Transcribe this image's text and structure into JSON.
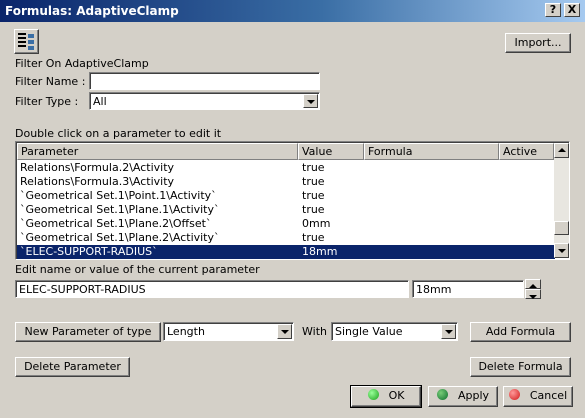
{
  "window": {
    "title": "Formulas: AdaptiveClamp",
    "help_button": "?",
    "close_button": "X"
  },
  "toolbar": {
    "import_label": "Import..."
  },
  "filter": {
    "heading": "Filter On AdaptiveClamp",
    "name_label": "Filter Name :",
    "name_value": "",
    "type_label": "Filter Type :",
    "type_value": "All"
  },
  "table": {
    "instruction": "Double click on a parameter to edit it",
    "columns": [
      "Parameter",
      "Value",
      "Formula",
      "Active"
    ],
    "rows": [
      {
        "parameter": "Relations\\Formula.2\\Activity",
        "value": "true",
        "formula": "",
        "active": ""
      },
      {
        "parameter": "Relations\\Formula.3\\Activity",
        "value": "true",
        "formula": "",
        "active": ""
      },
      {
        "parameter": "`Geometrical Set.1\\Point.1\\Activity`",
        "value": "true",
        "formula": "",
        "active": ""
      },
      {
        "parameter": "`Geometrical Set.1\\Plane.1\\Activity`",
        "value": "true",
        "formula": "",
        "active": ""
      },
      {
        "parameter": "`Geometrical Set.1\\Plane.2\\Offset`",
        "value": "0mm",
        "formula": "",
        "active": ""
      },
      {
        "parameter": "`Geometrical Set.1\\Plane.2\\Activity`",
        "value": "true",
        "formula": "",
        "active": ""
      },
      {
        "parameter": "`ELEC-SUPPORT-RADIUS`",
        "value": "18mm",
        "formula": "",
        "active": ""
      }
    ]
  },
  "edit": {
    "label": "Edit name or value of the current parameter",
    "name_value": "ELEC-SUPPORT-RADIUS",
    "value_value": "18mm"
  },
  "new_param": {
    "button_label": "New Parameter of type",
    "type_value": "Length",
    "with_label": "With",
    "with_value": "Single Value",
    "add_formula_label": "Add Formula"
  },
  "actions": {
    "delete_parameter_label": "Delete Parameter",
    "delete_formula_label": "Delete Formula",
    "ok_label": "OK",
    "apply_label": "Apply",
    "cancel_label": "Cancel"
  },
  "colors": {
    "selection": "#0a246a",
    "ok_ball": "#1aa01a",
    "apply_ball": "#0c6e2e",
    "cancel_ball": "#d01818"
  }
}
